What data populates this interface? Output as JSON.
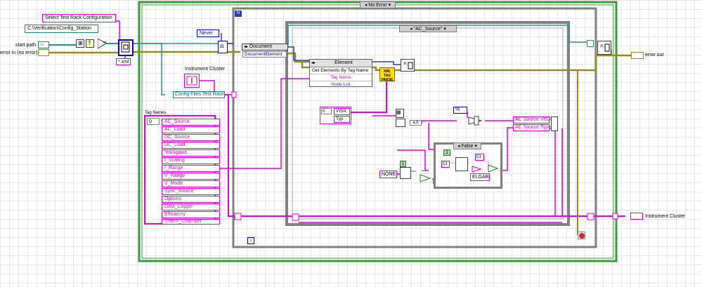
{
  "controls": {
    "select_config_label": "Select Test Rack Configuration",
    "config_station_path": "C:\\Verification\\Config_Station",
    "start_path_label": "start path",
    "error_in_label": "error in (no error)",
    "xml_pattern": "*.xml",
    "never_label": "Never",
    "instrument_cluster_label": "Instrument Cluster",
    "config_files_bundle": "Config Files.Test Rack"
  },
  "case_outer": {
    "selector": "No Error"
  },
  "case_inner": {
    "selector": "\"AC_Source\""
  },
  "case_false": {
    "selector": "False"
  },
  "document_node": {
    "title": "Document",
    "property": "DocumentElement"
  },
  "element_node": {
    "title": "Element",
    "method": "Get Elements By Tag Name",
    "params": [
      "Tag Name",
      "Node List"
    ]
  },
  "xml_parser_label": "XML TAG PARSE",
  "tag_names": {
    "label": "Tag Names",
    "index": "0",
    "items": [
      "AC_Source",
      "AC_Load",
      "DC_Source",
      "DC_Load",
      "Yokogawa",
      "I_Scaling",
      "I_Range",
      "V_Range",
      "V_Mode",
      "Sync_Source",
      "Options",
      "Data_Logger",
      "Efficiecny",
      "Therm_Chamber"
    ]
  },
  "visa_cluster": {
    "index": "0",
    "fields": [
      "VISA",
      "Typ"
    ]
  },
  "unbundle_label": "a,b",
  "percent_label": "%",
  "ac_source_outputs": [
    "AC Source.VISA",
    "AC Source.Type"
  ],
  "none_const": "NONE",
  "str_consts": [
    "CI",
    "CI"
  ],
  "elgar_const": "ELGAR",
  "num_consts": [
    "1",
    "1"
  ],
  "loop_iteration": "i",
  "outputs": {
    "error_out": "error out",
    "instrument_cluster": "Instrument Cluster"
  },
  "colors": {
    "grid": "#e6e6e6",
    "outer_frame": "#3a9a3a",
    "error_wire": "#9a8a18",
    "pink_wire": "#e000e0",
    "blue_wire": "#2040c0",
    "teal_wire": "#2f8f8f"
  }
}
